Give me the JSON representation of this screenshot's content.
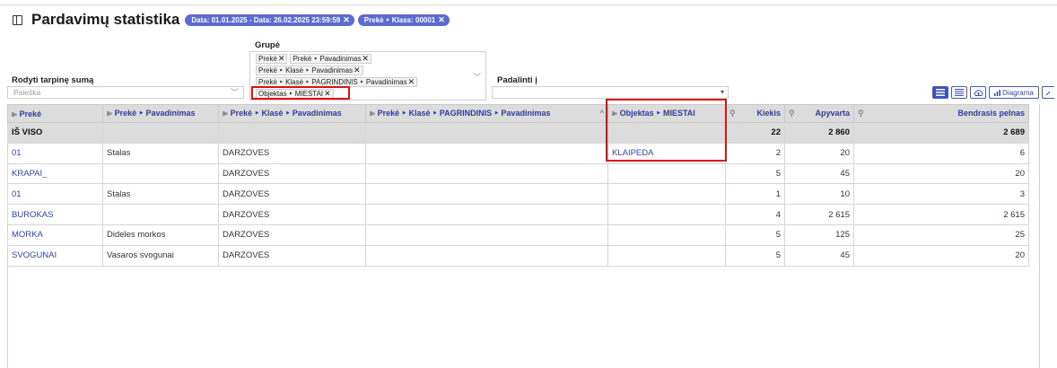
{
  "header": {
    "title": "Pardavimų statistika",
    "filters": [
      {
        "label": "Data: 01.01.2025 - Data: 26.02.2025 23:59:59"
      },
      {
        "label": "Prekė ‣ Klass: 00001"
      }
    ],
    "chip_close": "✕"
  },
  "controls": {
    "subtotal_label": "Rodyti tarpinę sumą",
    "search_placeholder": "Paieška",
    "group_label": "Grupė",
    "group_tags": [
      [
        "Prekė",
        "Prekė ‣ Pavadinimas"
      ],
      [
        "Prekė ‣ Klasė ‣ Pavadinimas"
      ],
      [
        "Prekė ‣ Klasė ‣ PAGRINDINIS ‣ Pavadinimas"
      ],
      [
        "Objektas ‣ MIESTAI"
      ]
    ],
    "split_label": "Padalinti į",
    "diagram_label": "Diagrama",
    "dropdown_caret": "▾",
    "select_caret": "﹀"
  },
  "table": {
    "columns": [
      {
        "label": "Prekė",
        "pin": "⊫"
      },
      {
        "label": "Prekė ‣ Pavadinimas",
        "pin": "⊫"
      },
      {
        "label": "Prekė ‣ Klasė ‣ Pavadinimas",
        "pin": "⊫"
      },
      {
        "label": "Prekė ‣ Klasė ‣ PAGRINDINIS ‣ Pavadinimas",
        "pin": "⊫",
        "sort": "^"
      },
      {
        "label": "Objektas ‣ MIESTAI",
        "pin": "⊫"
      },
      {
        "label": "Kiekis",
        "wrench": "⚲"
      },
      {
        "label": "Apyvarta",
        "wrench": "⚲"
      },
      {
        "label": "Bendrasis pelnas",
        "wrench": "⚲"
      }
    ],
    "total": {
      "label": "IŠ VISO",
      "kiekis": "22",
      "apyvarta": "2 860",
      "pelnas": "2 689"
    },
    "rows": [
      {
        "preke": "01",
        "pavadinimas": "Stalas",
        "klase": "DARZOVES",
        "pagrindinis": "",
        "miestai": "KLAIPEDA",
        "kiekis": "2",
        "apyvarta": "20",
        "pelnas": "6"
      },
      {
        "preke": "KRAPAI_",
        "pavadinimas": "",
        "klase": "DARZOVES",
        "pagrindinis": "",
        "miestai": "",
        "kiekis": "5",
        "apyvarta": "45",
        "pelnas": "20"
      },
      {
        "preke": "01",
        "pavadinimas": "Stalas",
        "klase": "DARZOVES",
        "pagrindinis": "",
        "miestai": "",
        "kiekis": "1",
        "apyvarta": "10",
        "pelnas": "3"
      },
      {
        "preke": "BUROKAS",
        "pavadinimas": "",
        "klase": "DARZOVES",
        "pagrindinis": "",
        "miestai": "",
        "kiekis": "4",
        "apyvarta": "2 615",
        "pelnas": "2 615"
      },
      {
        "preke": "MORKA",
        "pavadinimas": "Dideles morkos",
        "klase": "DARZOVES",
        "pagrindinis": "",
        "miestai": "",
        "kiekis": "5",
        "apyvarta": "125",
        "pelnas": "25"
      },
      {
        "preke": "SVOGUNAI",
        "pavadinimas": "Vasaros svogunai",
        "klase": "DARZOVES",
        "pagrindinis": "",
        "miestai": "",
        "kiekis": "5",
        "apyvarta": "45",
        "pelnas": "20"
      }
    ]
  },
  "colors": {
    "accent": "#5b6bd1",
    "link": "#2e45b8",
    "highlight": "#e01010",
    "header_bg": "#dcdcdc"
  }
}
